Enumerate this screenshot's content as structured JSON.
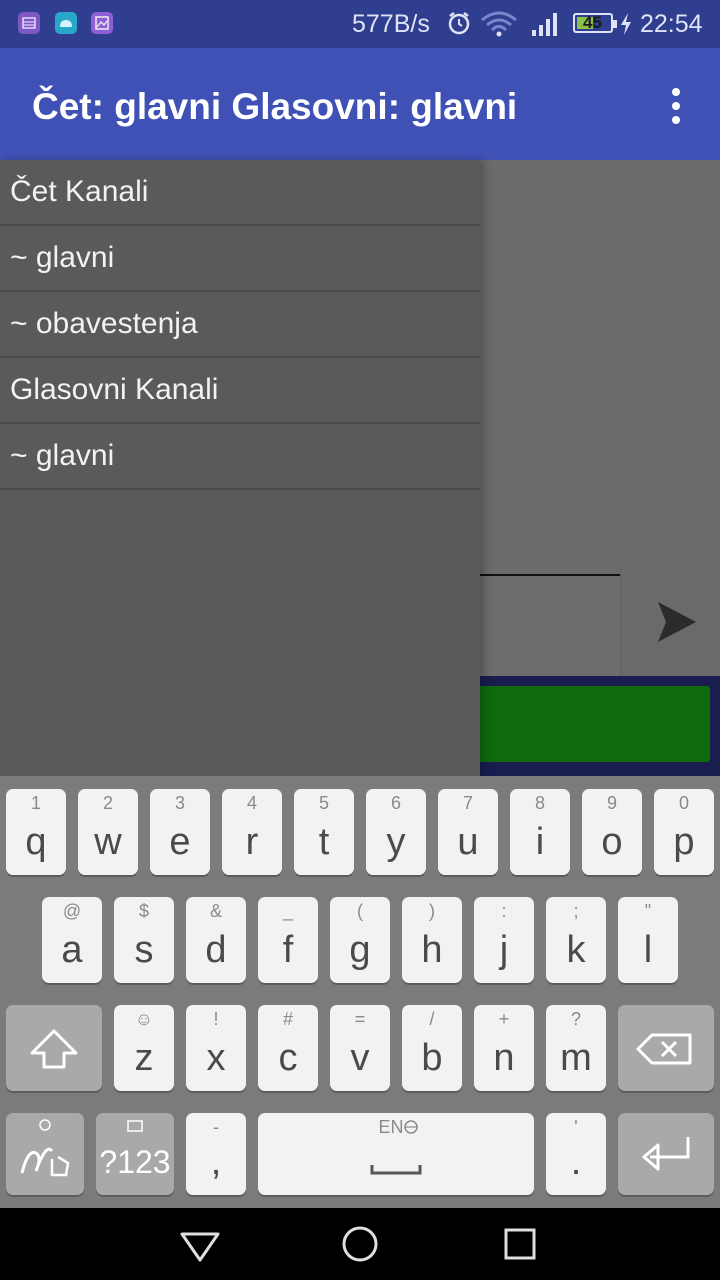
{
  "status_bar": {
    "net_speed": "577B/s",
    "battery_level": "45",
    "time": "22:54",
    "icons": [
      "notification-app-icon",
      "android-debug-icon",
      "gallery-icon",
      "alarm-icon",
      "wifi-icon",
      "signal-icon",
      "battery-icon",
      "charging-icon"
    ]
  },
  "app_bar": {
    "title": "Čet: glavni Glasovni: glavni",
    "overflow_icon": "more-vert-icon"
  },
  "drawer": {
    "items": [
      {
        "label": "Čet Kanali"
      },
      {
        "label": "~ glavni"
      },
      {
        "label": "~ obavestenja"
      },
      {
        "label": "Glasovni Kanali"
      },
      {
        "label": "~ glavni"
      }
    ]
  },
  "composer": {
    "send_icon": "send-icon"
  },
  "colors": {
    "app_bar": "#3f51b5",
    "status_bar": "#2f3e8f",
    "voice_active": "#0d6b0d"
  },
  "keyboard": {
    "row1": [
      {
        "key": "q",
        "hint": "1"
      },
      {
        "key": "w",
        "hint": "2"
      },
      {
        "key": "e",
        "hint": "3"
      },
      {
        "key": "r",
        "hint": "4"
      },
      {
        "key": "t",
        "hint": "5"
      },
      {
        "key": "y",
        "hint": "6"
      },
      {
        "key": "u",
        "hint": "7"
      },
      {
        "key": "i",
        "hint": "8"
      },
      {
        "key": "o",
        "hint": "9"
      },
      {
        "key": "p",
        "hint": "0"
      }
    ],
    "row2": [
      {
        "key": "a",
        "hint": "@"
      },
      {
        "key": "s",
        "hint": "$"
      },
      {
        "key": "d",
        "hint": "&"
      },
      {
        "key": "f",
        "hint": "_"
      },
      {
        "key": "g",
        "hint": "("
      },
      {
        "key": "h",
        "hint": ")"
      },
      {
        "key": "j",
        "hint": ":"
      },
      {
        "key": "k",
        "hint": ";"
      },
      {
        "key": "l",
        "hint": "\""
      }
    ],
    "row3": [
      {
        "key": "z",
        "hint": "☺"
      },
      {
        "key": "x",
        "hint": "!"
      },
      {
        "key": "c",
        "hint": "#"
      },
      {
        "key": "v",
        "hint": "="
      },
      {
        "key": "b",
        "hint": "/"
      },
      {
        "key": "n",
        "hint": "+"
      },
      {
        "key": "m",
        "hint": "?"
      }
    ],
    "symbols_label": "?123",
    "comma_key": ",",
    "comma_hint": "-",
    "space_hint": "EN",
    "period_key": ".",
    "period_hint": "'"
  }
}
